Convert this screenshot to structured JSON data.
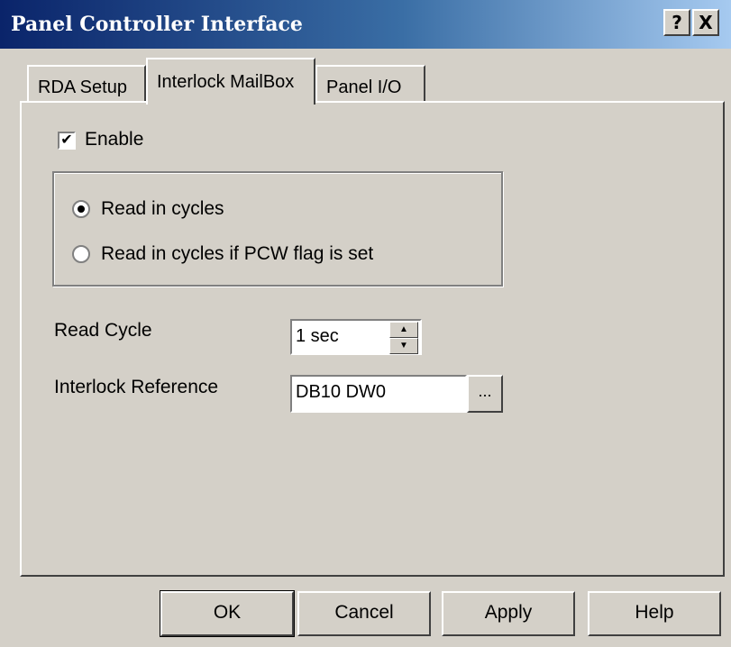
{
  "window": {
    "title": "Panel Controller Interface",
    "help_button": "?",
    "close_button": "X"
  },
  "tabs": [
    {
      "label": "RDA Setup",
      "active": false
    },
    {
      "label": "Interlock MailBox",
      "active": true
    },
    {
      "label": "Panel I/O",
      "active": false
    }
  ],
  "mailbox": {
    "enable": {
      "label": "Enable",
      "checked": true
    },
    "read_mode": {
      "options": [
        {
          "label": "Read in cycles",
          "selected": true
        },
        {
          "label": "Read in cycles if PCW flag is set",
          "selected": false
        }
      ]
    },
    "read_cycle": {
      "label": "Read Cycle",
      "value": "1 sec"
    },
    "interlock_reference": {
      "label": "Interlock Reference",
      "value": "DB10 DW0",
      "browse_label": "..."
    }
  },
  "buttons": {
    "ok": "OK",
    "cancel": "Cancel",
    "apply": "Apply",
    "help": "Help"
  },
  "colors": {
    "title_gradient_start": "#0a246a",
    "title_gradient_end": "#a6caf0",
    "dialog_face": "#d4d0c8"
  }
}
